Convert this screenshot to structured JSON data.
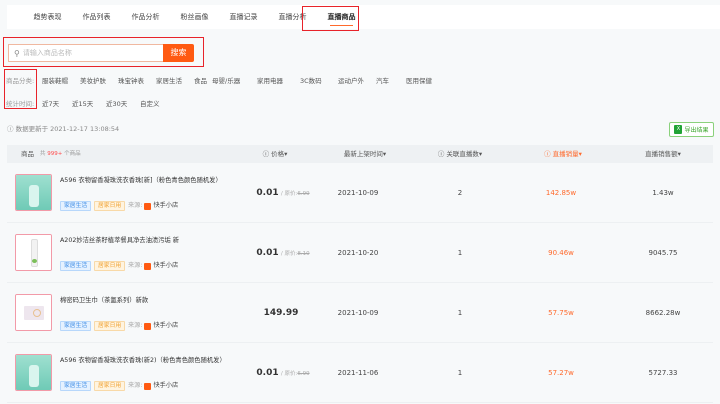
{
  "tabs": [
    "趋势表现",
    "作品列表",
    "作品分析",
    "粉丝画像",
    "直播记录",
    "直播分析",
    "直播商品"
  ],
  "active_tab": "直播商品",
  "search": {
    "placeholder": "请输入商品名称",
    "button": "搜索"
  },
  "category": {
    "label": "商品分类:",
    "items": [
      "服装鞋帽",
      "美妆护肤",
      "珠宝钟表",
      "家居生活",
      "食品",
      "母婴/乐器",
      "家用电器",
      "3C数码",
      "运动户外",
      "汽车",
      "医用保健"
    ]
  },
  "period": {
    "label": "统计时间:",
    "items": [
      "近7天",
      "近15天",
      "近30天",
      "自定义"
    ]
  },
  "update_text": "数据更新于 2021-12-17 13:08:54",
  "export_label": "导出结果",
  "table": {
    "product_header": "商品",
    "count_prefix": "共",
    "count": "999+",
    "count_suffix": "个商品",
    "headers": [
      "价格",
      "最新上架时间",
      "关联直播数",
      "直播销量",
      "直播销售额"
    ],
    "rows": [
      {
        "name": "A596 衣物留香凝珠洗衣香珠[新]（粉色青色颜色随机发）",
        "tag1": "家居生活",
        "tag2": "居家日用",
        "source_label": "来源:",
        "source": "快手小店",
        "price": "0.01",
        "orig_label": "/ 原价:",
        "orig": "6.99",
        "date": "2021-10-09",
        "lives": "2",
        "sales": "142.85w",
        "revenue": "1.43w",
        "img": "green"
      },
      {
        "name": "A202妙洁丝茶籽植萃餐具净去油渍污垢 新",
        "tag1": "家居生活",
        "tag2": "居家日用",
        "source_label": "来源:",
        "source": "快手小店",
        "price": "0.01",
        "orig_label": "/ 原价:",
        "orig": "8.10",
        "date": "2021-10-20",
        "lives": "1",
        "sales": "90.46w",
        "revenue": "9045.75",
        "img": "bottle"
      },
      {
        "name": "棉密码卫生巾（茶氲系列）新款",
        "tag1": "家居生活",
        "tag2": "居家日用",
        "source_label": "来源:",
        "source": "快手小店",
        "price": "149.99",
        "orig_label": "",
        "orig": "",
        "date": "2021-10-09",
        "lives": "1",
        "sales": "57.75w",
        "revenue": "8662.28w",
        "img": "box"
      },
      {
        "name": "A596 衣物留香凝珠洗衣香珠(新2)（粉色青色颜色随机发）",
        "tag1": "家居生活",
        "tag2": "居家日用",
        "source_label": "来源:",
        "source": "快手小店",
        "price": "0.01",
        "orig_label": "/ 原价:",
        "orig": "6.99",
        "date": "2021-11-06",
        "lives": "1",
        "sales": "57.27w",
        "revenue": "5727.33",
        "img": "green"
      }
    ]
  }
}
